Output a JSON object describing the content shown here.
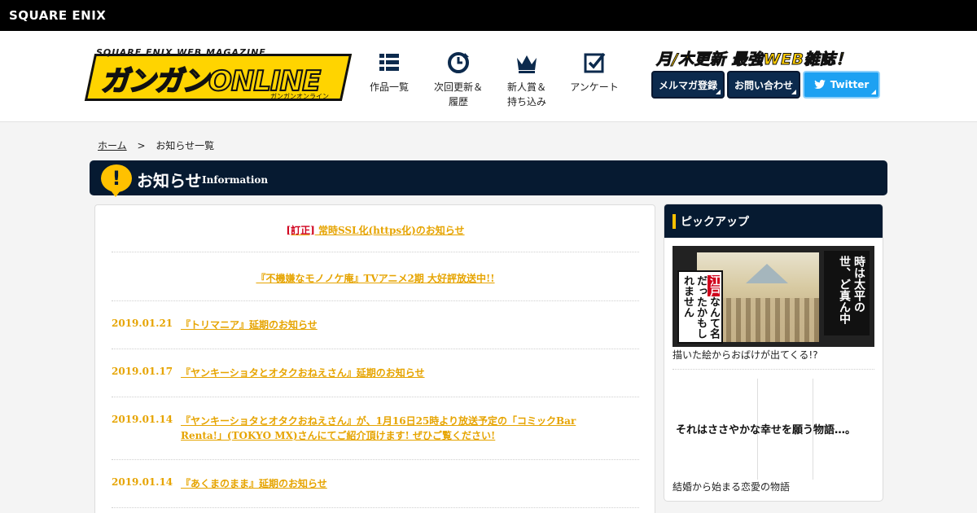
{
  "top_bar": {
    "logo": "SQUARE ENIX"
  },
  "header": {
    "brand_sub": "SQUARE ENIX WEB MAGAZINE",
    "brand_main": "ガンガンONLINE",
    "brand_small": "ガンガンオンライン",
    "nav": [
      {
        "line1": "作品一覧",
        "line2": "",
        "icon": "list-icon"
      },
      {
        "line1": "次回更新＆",
        "line2": "履歴",
        "icon": "clock-icon"
      },
      {
        "line1": "新人賞＆",
        "line2": "持ち込み",
        "icon": "crown-icon"
      },
      {
        "line1": "アンケート",
        "line2": "",
        "icon": "checkbox-icon"
      }
    ],
    "tagline": "月/木更新 最強WEB雑誌！",
    "buttons": {
      "mailmag": "メルマガ登録",
      "contact": "お問い合わせ",
      "twitter": "Twitter"
    }
  },
  "breadcrumb": {
    "home": "ホーム",
    "separator": ">",
    "current": "お知らせ一覧"
  },
  "section": {
    "icon_glyph": "!",
    "title": "お知らせ",
    "subtitle": "Information"
  },
  "notices": {
    "sticky": [
      {
        "tag": "[訂正]",
        "text": "常時SSL化(https化)のお知らせ"
      },
      {
        "tag": "",
        "text": "『不機嫌なモノノケ庵』TVアニメ2期 大好評放送中!!"
      }
    ],
    "items": [
      {
        "date": "2019.01.21",
        "text": "『トリマニア』延期のお知らせ"
      },
      {
        "date": "2019.01.17",
        "text": "『ヤンキーショタとオタクおねえさん』延期のお知らせ"
      },
      {
        "date": "2019.01.14",
        "text": "『ヤンキーショタとオタクおねえさん』が、1月16日25時より放送予定の「コミックBar Renta!」(TOKYO MX)さんにてご紹介頂けます! ぜひご覧ください!"
      },
      {
        "date": "2019.01.14",
        "text": "『あくまのまま』延期のお知らせ"
      }
    ]
  },
  "sidebar": {
    "title": "ピックアップ",
    "pickups": [
      {
        "caption": "描いた絵からおばけが出てくる!?",
        "image_text_left_a": "江戸",
        "image_text_left_b": "なんて名だったかもしれません",
        "image_text_right": "時は太平の世、ど真ん中"
      },
      {
        "caption": "結婚から始まる恋愛の物語",
        "image_text": "それはささやかな幸せを願う物語…。"
      }
    ]
  },
  "colors": {
    "navy": "#061a31",
    "accent_yellow": "#ffc100",
    "link_orange": "#e6a400",
    "red_tag": "#d0001c",
    "twitter": "#1da1f2"
  }
}
